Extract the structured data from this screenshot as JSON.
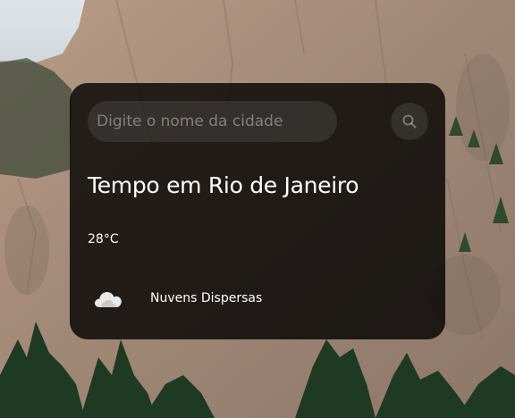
{
  "search": {
    "placeholder": "Digite o nome da cidade",
    "value": "",
    "button_icon": "search-icon"
  },
  "weather": {
    "title": "Tempo em Rio de Janeiro",
    "temperature": "28°C",
    "condition": "Nuvens Dispersas",
    "condition_icon": "cloud-icon"
  },
  "colors": {
    "card_background": "#000000",
    "text": "#ffffff"
  }
}
